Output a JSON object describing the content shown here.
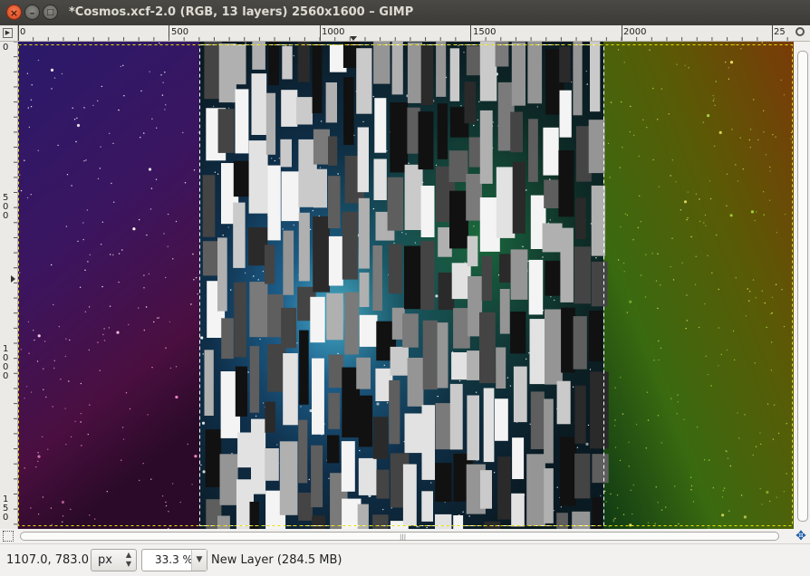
{
  "window": {
    "title": "*Cosmos.xcf-2.0 (RGB, 13 layers) 2560x1600 – GIMP",
    "close_glyph": "×",
    "min_glyph": "–",
    "max_glyph": "□"
  },
  "rulers": {
    "horizontal_labels": [
      "0",
      "500",
      "1000",
      "1500",
      "2000",
      "25"
    ],
    "vertical_labels": [
      "0",
      "5\n0\n0",
      "1\n0\n0\n0",
      "1\n5\n0"
    ]
  },
  "canvas": {
    "icons": {
      "quick_mask": "quick-mask-icon",
      "navigate": "navigate-icon",
      "zoom": "zoom-icon",
      "image_menu": "image-menu-icon"
    },
    "colors": {
      "left_nebula": "#3a1a6e",
      "right_nebula": "#4a6a08",
      "selection": "#ffffff"
    }
  },
  "statusbar": {
    "coordinates": "1107.0, 783.0",
    "unit": "px",
    "zoom": "33.3 %",
    "layer_info": "New Layer (284.5 MB)"
  }
}
